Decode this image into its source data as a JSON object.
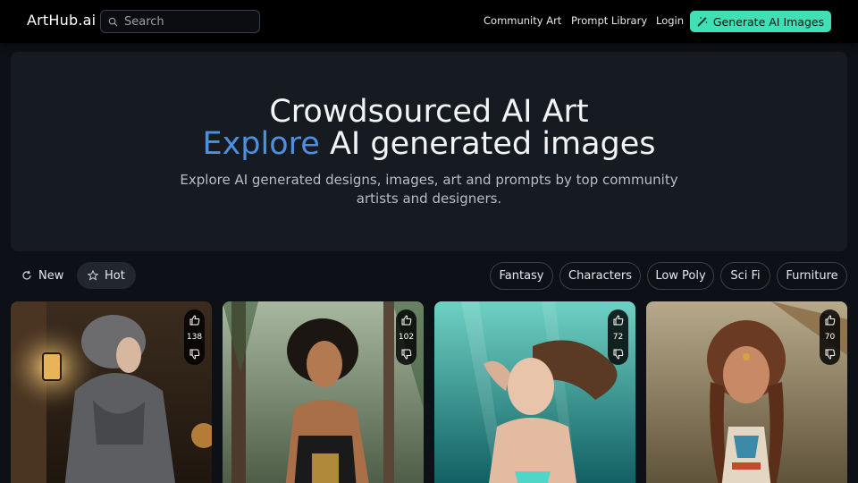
{
  "header": {
    "logo": "ArtHub.ai",
    "search_placeholder": "Search",
    "links": [
      "Community Art",
      "Prompt Library",
      "Login"
    ],
    "cta": "Generate AI Images"
  },
  "hero": {
    "line1": "Crowdsourced AI Art",
    "line2_accent": "Explore",
    "line2_rest": "AI generated images",
    "subtitle": "Explore AI generated designs, images, art and prompts by top community artists and designers."
  },
  "sort": {
    "new_label": "New",
    "hot_label": "Hot",
    "active": "Hot"
  },
  "categories": [
    "Fantasy",
    "Characters",
    "Low Poly",
    "Sci Fi",
    "Furniture"
  ],
  "cards": [
    {
      "likes": "138",
      "theme": "hooded-warrior",
      "bg_top": "#2a2118",
      "bg_bottom": "#4a3a2a"
    },
    {
      "likes": "102",
      "theme": "forest-warrior-woman",
      "bg_top": "#56705a",
      "bg_bottom": "#3d4a3a"
    },
    {
      "likes": "72",
      "theme": "underwater-woman",
      "bg_top": "#1e8c84",
      "bg_bottom": "#0f5f63"
    },
    {
      "likes": "70",
      "theme": "native-woman-braids",
      "bg_top": "#8a7a5a",
      "bg_bottom": "#5a4a36"
    }
  ],
  "colors": {
    "accent": "#4f8fe0",
    "cta": "#3ee0b4",
    "background": "#0d1117",
    "hero_panel": "#161b22"
  }
}
